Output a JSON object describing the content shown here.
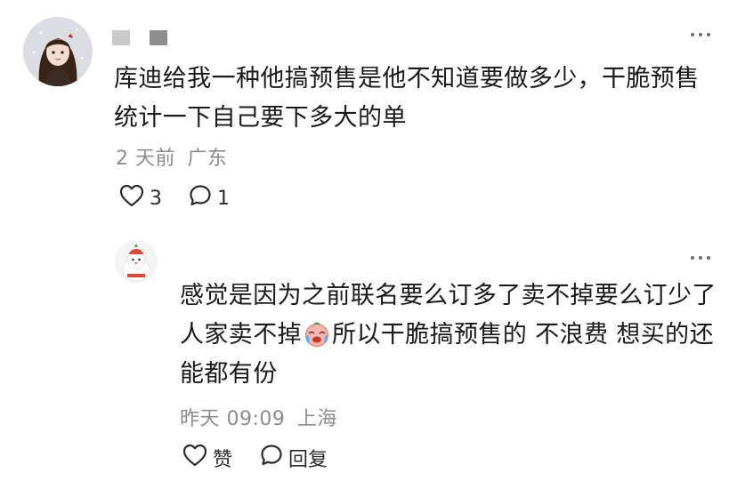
{
  "comment": {
    "text": "库迪给我一种他搞预售是他不知道要做多少，干脆预售统计一下自己要下多大的单",
    "time": "2 天前",
    "location": "广东",
    "like_count": "3",
    "reply_count": "1"
  },
  "reply": {
    "text_before_emoji": "感觉是因为之前联名要么订多了卖不掉要么订少了人家卖不掉",
    "emoji": "crying-face-emoji",
    "text_after_emoji": "所以干脆搞预售的 不浪费 想买的还能都有份",
    "time": "昨天 09:09",
    "location": "上海",
    "like_label": "赞",
    "reply_label": "回复"
  },
  "colors": {
    "text": "#1a1a1a",
    "meta": "#8c8c8c",
    "icon": "#2b2b2b"
  }
}
